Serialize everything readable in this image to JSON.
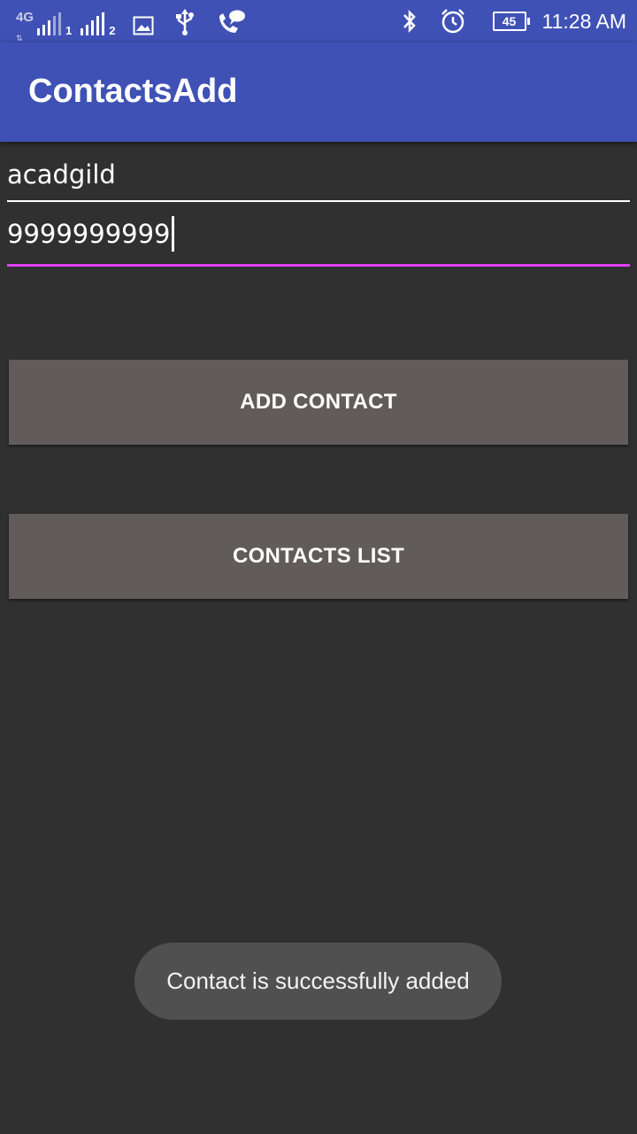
{
  "status_bar": {
    "network_type": "4G",
    "sim1_label": "1",
    "sim2_label": "2",
    "battery_level": "45",
    "time": "11:28 AM",
    "icons": [
      "signal-icon",
      "gallery-icon",
      "usb-icon",
      "call-message-icon",
      "bluetooth-icon",
      "alarm-icon",
      "battery-icon"
    ]
  },
  "app_bar": {
    "title": "ContactsAdd",
    "color": "#3f51b5"
  },
  "form": {
    "name_value": "acadgild",
    "phone_value": "9999999999",
    "focused_field": "phone",
    "accent_color": "#e040fb"
  },
  "buttons": {
    "add_contact": "ADD CONTACT",
    "contacts_list": "CONTACTS LIST"
  },
  "toast": {
    "message": "Contact is successfully added"
  }
}
